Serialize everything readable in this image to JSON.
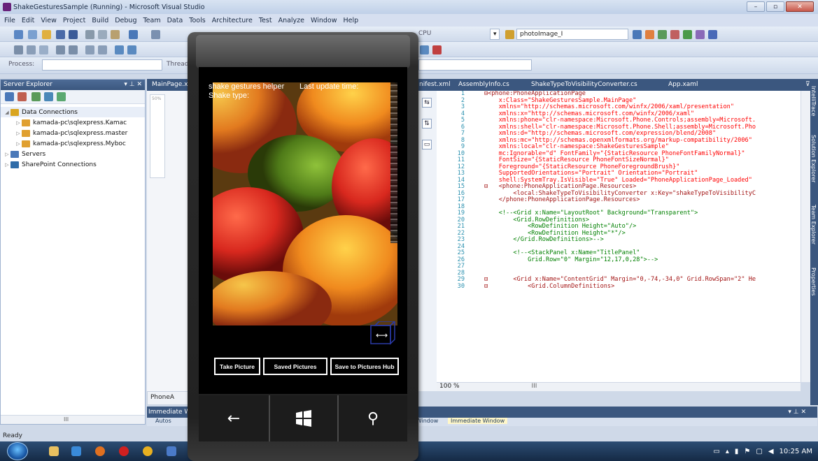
{
  "window": {
    "title": "ShakeGesturesSample (Running) - Microsoft Visual Studio",
    "controls": [
      "–",
      "▫",
      "✕"
    ]
  },
  "menu": [
    "File",
    "Edit",
    "View",
    "Project",
    "Build",
    "Debug",
    "Team",
    "Data",
    "Tools",
    "Architecture",
    "Test",
    "Analyze",
    "Window",
    "Help"
  ],
  "toolbar": {
    "platform_partial": "CPU",
    "find_combo": "photoImage_I",
    "process_label": "Process:",
    "thread_label": "Thread"
  },
  "server_explorer": {
    "title": "Server Explorer",
    "pin": "▾ ⊥ ✕",
    "tree": [
      {
        "label": "Data Connections",
        "level": 0,
        "expanded": true,
        "icon_color": "#d9a520"
      },
      {
        "label": "kamada-pc\\sqlexpress.Kamac",
        "level": 1,
        "expanded": false,
        "icon_color": "#e0a030"
      },
      {
        "label": "kamada-pc\\sqlexpress.master",
        "level": 1,
        "expanded": false,
        "icon_color": "#e0a030"
      },
      {
        "label": "kamada-pc\\sqlexpress.Myboc",
        "level": 1,
        "expanded": false,
        "icon_color": "#e0a030"
      },
      {
        "label": "Servers",
        "level": 0,
        "expanded": false,
        "icon_color": "#4a78b8"
      },
      {
        "label": "SharePoint Connections",
        "level": 0,
        "expanded": false,
        "icon_color": "#2f6ca8"
      }
    ],
    "scroll_label": "III"
  },
  "doc_tabs": {
    "main_page": "MainPage.xa",
    "manifest": "nifest.xml",
    "assembly": "AssemblyInfo.cs",
    "converter": "ShakeTypeToVisibilityConverter.cs",
    "app": "App.xaml",
    "overflow": "⊽"
  },
  "designer": {
    "zoom": "50%",
    "bottom_tab": "PhoneA",
    "split_buttons": [
      "⇆",
      "⇅",
      "▭"
    ]
  },
  "code": {
    "lines": [
      {
        "n": "1",
        "t": "⊟<phone:PhoneApplicationPage"
      },
      {
        "n": "2",
        "t": "    x:Class=\"ShakeGesturesSample.MainPage\""
      },
      {
        "n": "3",
        "t": "    xmlns=\"http://schemas.microsoft.com/winfx/2006/xaml/presentation\""
      },
      {
        "n": "4",
        "t": "    xmlns:x=\"http://schemas.microsoft.com/winfx/2006/xaml\""
      },
      {
        "n": "5",
        "t": "    xmlns:phone=\"clr-namespace:Microsoft.Phone.Controls;assembly=Microsoft."
      },
      {
        "n": "6",
        "t": "    xmlns:shell=\"clr-namespace:Microsoft.Phone.Shell;assembly=Microsoft.Pho"
      },
      {
        "n": "7",
        "t": "    xmlns:d=\"http://schemas.microsoft.com/expression/blend/2008\""
      },
      {
        "n": "8",
        "t": "    xmlns:mc=\"http://schemas.openxmlformats.org/markup-compatibility/2006\""
      },
      {
        "n": "9",
        "t": "    xmlns:local=\"clr-namespace:ShakeGesturesSample\""
      },
      {
        "n": "10",
        "t": "    mc:Ignorable=\"d\" FontFamily=\"{StaticResource PhoneFontFamilyNormal}\""
      },
      {
        "n": "11",
        "t": "    FontSize=\"{StaticResource PhoneFontSizeNormal}\""
      },
      {
        "n": "12",
        "t": "    Foreground=\"{StaticResource PhoneForegroundBrush}\""
      },
      {
        "n": "13",
        "t": "    SupportedOrientations=\"Portrait\" Orientation=\"Portrait\""
      },
      {
        "n": "14",
        "t": "    shell:SystemTray.IsVisible=\"True\" Loaded=\"PhoneApplicationPage_Loaded\""
      },
      {
        "n": "15",
        "t": "⊟   <phone:PhoneApplicationPage.Resources>"
      },
      {
        "n": "16",
        "t": "        <local:ShakeTypeToVisibilityConverter x:Key=\"shakeTypeToVisibilityC"
      },
      {
        "n": "17",
        "t": "    </phone:PhoneApplicationPage.Resources>"
      },
      {
        "n": "18",
        "t": ""
      },
      {
        "n": "19",
        "t": "    <!--<Grid x:Name=\"LayoutRoot\" Background=\"Transparent\">"
      },
      {
        "n": "20",
        "t": "        <Grid.RowDefinitions>"
      },
      {
        "n": "21",
        "t": "            <RowDefinition Height=\"Auto\"/>"
      },
      {
        "n": "22",
        "t": "            <RowDefinition Height=\"*\"/>"
      },
      {
        "n": "23",
        "t": "        </Grid.RowDefinitions>-->"
      },
      {
        "n": "24",
        "t": ""
      },
      {
        "n": "25",
        "t": "        <!--<StackPanel x:Name=\"TitlePanel\""
      },
      {
        "n": "26",
        "t": "            Grid.Row=\"0\" Margin=\"12,17,0,28\">-->"
      },
      {
        "n": "27",
        "t": ""
      },
      {
        "n": "28",
        "t": ""
      },
      {
        "n": "29",
        "t": "⊟       <Grid x:Name=\"ContentGrid\" Margin=\"0,-74,-34,0\" Grid.RowSpan=\"2\" He"
      },
      {
        "n": "30",
        "t": "⊟           <Grid.ColumnDefinitions>"
      }
    ],
    "zoom": "100 %",
    "hscroll_label": "III"
  },
  "side_rail": [
    "IntelliTrace",
    "Solution Explorer",
    "Team Explorer",
    "Properties"
  ],
  "immediate": {
    "title": "Immediate W",
    "tabs_partial": "Autos",
    "window_tab": "l Window",
    "immediate_tab": "Immediate Window",
    "controls": "▾ ⊥ ✕"
  },
  "status": "Ready",
  "taskbar": {
    "clock": "10:25 AM"
  },
  "phone": {
    "app_title": "shake gestures helper",
    "last_update_label": "Last update time:",
    "shake_type_label": "Shake type:",
    "buttons": [
      "Take Picture",
      "Saved Pictures",
      "Save to Pictures Hub"
    ],
    "nav_keys": {
      "back": "←",
      "search": "⚲"
    }
  },
  "colors": {
    "vs_blue": "#3b577f",
    "editor_keyword": "#0000ff",
    "editor_string": "#a31515",
    "editor_comment": "#008000",
    "line_number": "#2b91af"
  }
}
